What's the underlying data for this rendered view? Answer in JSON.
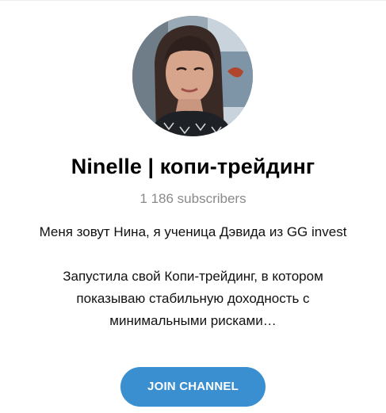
{
  "channel": {
    "title": "Ninelle | копи-трейдинг",
    "subscribers": "1 186 subscribers",
    "description": {
      "line1": "Меня зовут Нина, я ученица Дэвида из GG invest",
      "line2": "Запустила свой Копи-трейдинг, в котором",
      "line3": "показываю стабильную доходность с",
      "line4": "минимальными рисками…"
    },
    "join_label": "JOIN CHANNEL"
  },
  "colors": {
    "accent": "#3a8fd1",
    "subtext": "#8a8a8a"
  }
}
